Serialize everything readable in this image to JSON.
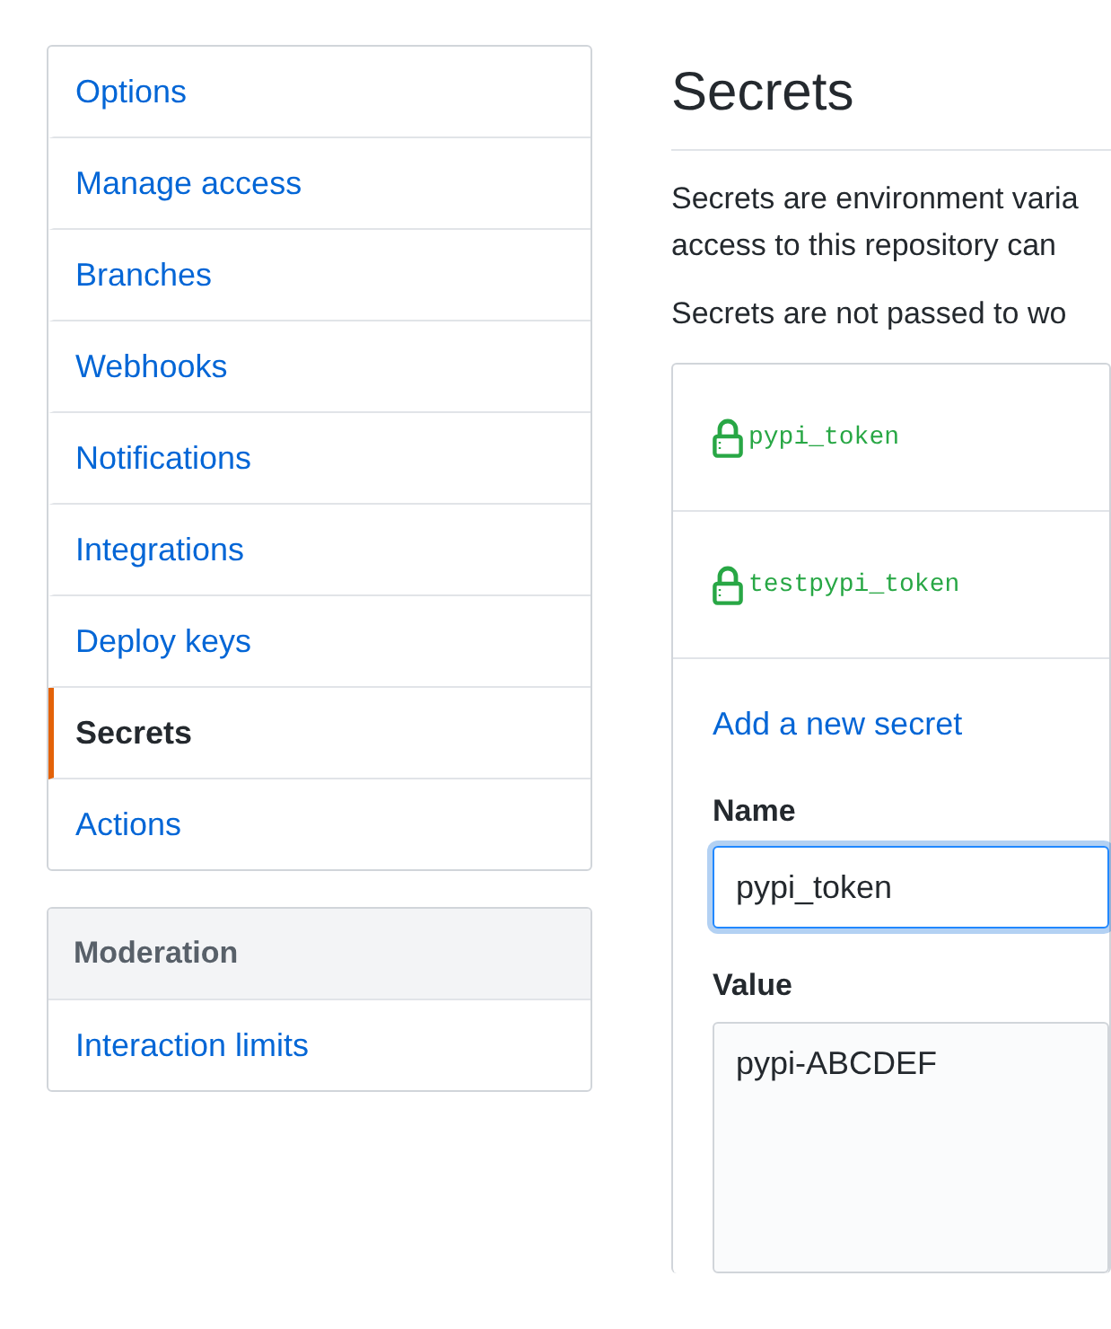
{
  "sidebar": {
    "groups": [
      {
        "items": [
          {
            "label": "Options",
            "selected": false
          },
          {
            "label": "Manage access",
            "selected": false
          },
          {
            "label": "Branches",
            "selected": false
          },
          {
            "label": "Webhooks",
            "selected": false
          },
          {
            "label": "Notifications",
            "selected": false
          },
          {
            "label": "Integrations",
            "selected": false
          },
          {
            "label": "Deploy keys",
            "selected": false
          },
          {
            "label": "Secrets",
            "selected": true
          },
          {
            "label": "Actions",
            "selected": false
          }
        ]
      },
      {
        "heading": "Moderation",
        "items": [
          {
            "label": "Interaction limits",
            "selected": false
          }
        ]
      }
    ]
  },
  "main": {
    "title": "Secrets",
    "paragraphs": [
      "Secrets are environment varia\naccess to this repository can",
      "Secrets are not passed to wo"
    ],
    "secrets": [
      {
        "name": "pypi_token"
      },
      {
        "name": "testpypi_token"
      }
    ],
    "add_link": "Add a new secret",
    "form": {
      "name_label": "Name",
      "name_value": "pypi_token",
      "name_focused": true,
      "value_label": "Value",
      "value_value": "pypi-ABCDEF"
    }
  }
}
